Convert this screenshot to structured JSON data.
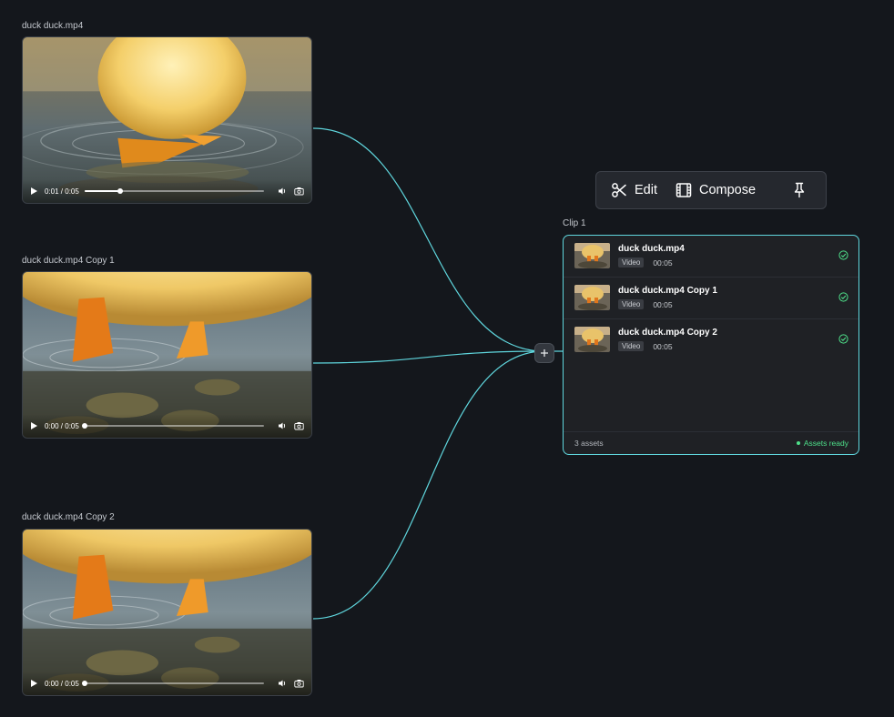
{
  "nodes": [
    {
      "title": "duck duck.mp4",
      "time": "0:01 / 0:05",
      "progress": 0.2
    },
    {
      "title": "duck duck.mp4 Copy 1",
      "time": "0:00 / 0:05",
      "progress": 0.0
    },
    {
      "title": "duck duck.mp4 Copy 2",
      "time": "0:00 / 0:05",
      "progress": 0.0
    }
  ],
  "toolbar": {
    "edit_label": "Edit",
    "compose_label": "Compose"
  },
  "clip": {
    "label": "Clip 1",
    "assets": [
      {
        "name": "duck duck.mp4",
        "type": "Video",
        "duration": "00:05"
      },
      {
        "name": "duck duck.mp4 Copy 1",
        "type": "Video",
        "duration": "00:05"
      },
      {
        "name": "duck duck.mp4 Copy 2",
        "type": "Video",
        "duration": "00:05"
      }
    ],
    "count": "3 assets",
    "status": "Assets ready"
  },
  "colors": {
    "background": "#14171c",
    "accent": "#5fd6dd",
    "ready": "#4ee08a"
  }
}
